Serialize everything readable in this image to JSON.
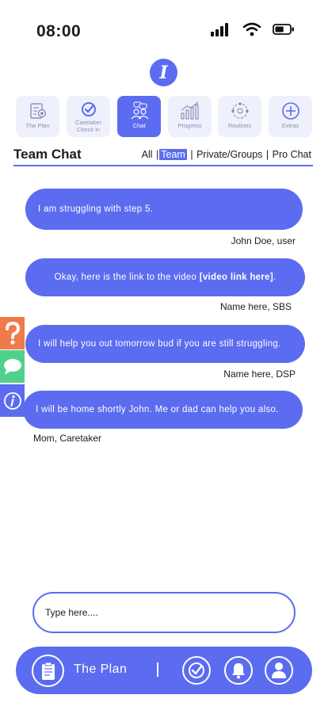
{
  "status_bar": {
    "time": "08:00",
    "battery_percent": 60
  },
  "app": {
    "logo_letter": "I"
  },
  "nav_tiles": [
    {
      "label": "The Plan",
      "icon": "checklist-target-icon",
      "active": false
    },
    {
      "label": "Caretaker Check in",
      "icon": "checkmark-circle-icon",
      "active": false
    },
    {
      "label": "Chat",
      "icon": "people-chat-icon",
      "active": true
    },
    {
      "label": "Progress",
      "icon": "bar-chart-icon",
      "active": false
    },
    {
      "label": "Routines",
      "icon": "routines-cycle-icon",
      "active": false
    },
    {
      "label": "Extras",
      "icon": "plus-circle-icon",
      "active": false
    }
  ],
  "chat": {
    "title": "Team Chat",
    "filters": {
      "all": "All",
      "team": "Team",
      "private_groups": "Private/Groups",
      "pro_chat": "Pro Chat",
      "selected": "Team"
    },
    "messages": [
      {
        "text": "I am struggling with step 5.",
        "sender": "John Doe, user"
      },
      {
        "text_before": "Okay, here is the link to the video ",
        "link": "[video link here]",
        "text_after": ".",
        "sender": "Name here, SBS"
      },
      {
        "text": "I will help you out tomorrow bud if you are still struggling.",
        "sender": "Name here, DSP"
      },
      {
        "text": "I will be home shortly John. Me or dad can help you also.",
        "sender": "Mom, Caretaker"
      }
    ]
  },
  "side_tabs": [
    {
      "icon": "question-mark-icon",
      "color": "#f07a4a"
    },
    {
      "icon": "speech-bubble-icon",
      "color": "#4fd18b"
    },
    {
      "icon": "info-icon",
      "color": "#5b6cf0"
    }
  ],
  "input": {
    "placeholder": "Type here...."
  },
  "bottom_bar": {
    "plan_label": "The Plan",
    "icons": [
      "clipboard-icon",
      "check-circle-icon",
      "bell-icon",
      "user-icon"
    ]
  },
  "colors": {
    "accent": "#5b6cf0",
    "tile_bg": "#eef0fb",
    "help_orange": "#f07a4a",
    "chat_green": "#4fd18b"
  }
}
